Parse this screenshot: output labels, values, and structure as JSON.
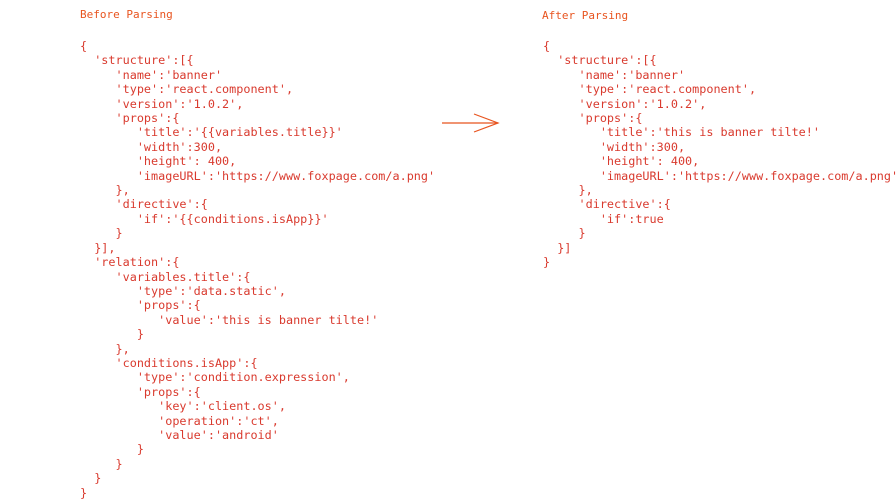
{
  "before": {
    "title": "Before Parsing",
    "lines": [
      "{",
      "  'structure':[{",
      "     'name':'banner'",
      "     'type':'react.component',",
      "     'version':'1.0.2',",
      "     'props':{",
      "        'title':'{{variables.title}}'",
      "        'width':300,",
      "        'height': 400,",
      "        'imageURL':'https://www.foxpage.com/a.png'",
      "     },",
      "     'directive':{",
      "        'if':'{{conditions.isApp}}'",
      "     }",
      "  }],",
      "  'relation':{",
      "     'variables.title':{",
      "        'type':'data.static',",
      "        'props':{",
      "           'value':'this is banner tilte!'",
      "        }",
      "     },",
      "     'conditions.isApp':{",
      "        'type':'condition.expression',",
      "        'props':{",
      "           'key':'client.os',",
      "           'operation':'ct',",
      "           'value':'android'",
      "        }",
      "     }",
      "  }",
      "}"
    ]
  },
  "after": {
    "title": "After Parsing",
    "lines": [
      "{",
      "  'structure':[{",
      "     'name':'banner'",
      "     'type':'react.component',",
      "     'version':'1.0.2',",
      "     'props':{",
      "        'title':'this is banner tilte!'",
      "        'width':300,",
      "        'height': 400,",
      "        'imageURL':'https://www.foxpage.com/a.png'",
      "     },",
      "     'directive':{",
      "        'if':true",
      "     }",
      "  }]",
      "}"
    ]
  },
  "arrow_icon": "right-arrow-icon",
  "colors": {
    "title": "#e8541f",
    "code": "#d93a2e",
    "arrow": "#e8541f"
  }
}
